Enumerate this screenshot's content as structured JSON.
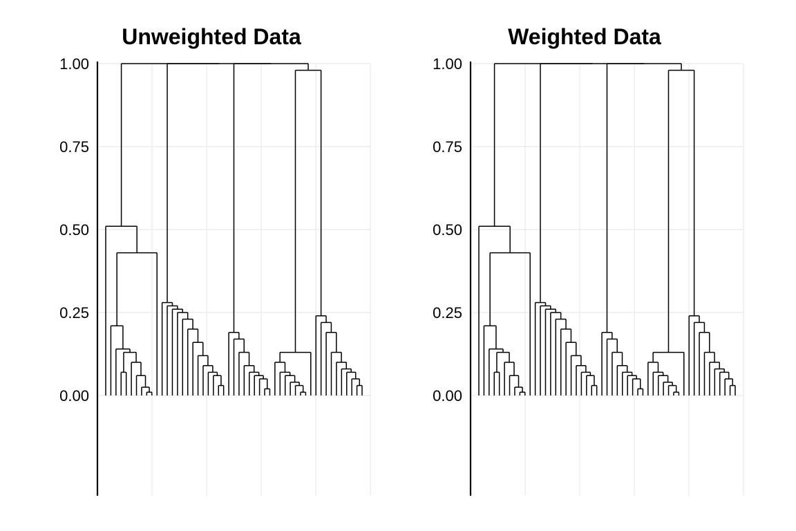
{
  "chart_data": [
    {
      "type": "dendrogram",
      "title": "Unweighted Data",
      "ylim": [
        0.0,
        1.0
      ],
      "yticks": [
        0.0,
        0.25,
        0.5,
        0.75,
        1.0
      ],
      "ytick_labels": [
        "0.00",
        "0.25",
        "0.50",
        "0.75",
        "1.00"
      ],
      "n_leaves": 47,
      "merges": [
        {
          "height": 0.01,
          "left": "L0",
          "right": "L1",
          "id": "M0"
        },
        {
          "height": 0.025,
          "left": "L2",
          "right": "M0",
          "id": "M1"
        },
        {
          "height": 0.06,
          "left": "L3",
          "right": "M1",
          "id": "M2"
        },
        {
          "height": 0.1,
          "left": "L4",
          "right": "M2",
          "id": "M3"
        },
        {
          "height": 0.07,
          "left": "L5",
          "right": "L6",
          "id": "M4"
        },
        {
          "height": 0.13,
          "left": "M4",
          "right": "M3",
          "id": "M5"
        },
        {
          "height": 0.14,
          "left": "L7",
          "right": "M5",
          "id": "M6"
        },
        {
          "height": 0.21,
          "left": "L8",
          "right": "M6",
          "id": "M7"
        },
        {
          "height": 0.43,
          "left": "M7",
          "right": "L9",
          "id": "M8"
        },
        {
          "height": 0.51,
          "left": "L10",
          "right": "M8",
          "id": "C1"
        },
        {
          "height": 0.03,
          "left": "L11",
          "right": "L12",
          "id": "M10"
        },
        {
          "height": 0.06,
          "left": "L13",
          "right": "M10",
          "id": "M11"
        },
        {
          "height": 0.07,
          "left": "L14",
          "right": "M11",
          "id": "M12"
        },
        {
          "height": 0.09,
          "left": "L15",
          "right": "M12",
          "id": "M13"
        },
        {
          "height": 0.12,
          "left": "L16",
          "right": "M13",
          "id": "M14"
        },
        {
          "height": 0.16,
          "left": "L17",
          "right": "M14",
          "id": "M15"
        },
        {
          "height": 0.2,
          "left": "L18",
          "right": "M15",
          "id": "M16"
        },
        {
          "height": 0.23,
          "left": "L19",
          "right": "M16",
          "id": "M17"
        },
        {
          "height": 0.25,
          "left": "L20",
          "right": "M17",
          "id": "M18"
        },
        {
          "height": 0.26,
          "left": "L21",
          "right": "M18",
          "id": "M19"
        },
        {
          "height": 0.27,
          "left": "L22",
          "right": "M19",
          "id": "M20"
        },
        {
          "height": 0.28,
          "left": "L23",
          "right": "M20",
          "id": "C2"
        },
        {
          "height": 0.02,
          "left": "L24",
          "right": "L25",
          "id": "M22"
        },
        {
          "height": 0.05,
          "left": "L26",
          "right": "M22",
          "id": "M23"
        },
        {
          "height": 0.06,
          "left": "L27",
          "right": "M23",
          "id": "M24"
        },
        {
          "height": 0.07,
          "left": "L28",
          "right": "M24",
          "id": "M25"
        },
        {
          "height": 0.09,
          "left": "L29",
          "right": "M25",
          "id": "M26"
        },
        {
          "height": 0.13,
          "left": "L30",
          "right": "M26",
          "id": "M27"
        },
        {
          "height": 0.17,
          "left": "L31",
          "right": "M27",
          "id": "M28"
        },
        {
          "height": 0.19,
          "left": "L32",
          "right": "M28",
          "id": "C3"
        },
        {
          "height": 0.01,
          "left": "L33",
          "right": "L34",
          "id": "M30"
        },
        {
          "height": 0.03,
          "left": "L35",
          "right": "M30",
          "id": "M31"
        },
        {
          "height": 0.04,
          "left": "L36",
          "right": "M31",
          "id": "M32"
        },
        {
          "height": 0.06,
          "left": "L37",
          "right": "M32",
          "id": "M33"
        },
        {
          "height": 0.07,
          "left": "L38",
          "right": "M33",
          "id": "M34"
        },
        {
          "height": 0.1,
          "left": "L39",
          "right": "M34",
          "id": "M35"
        },
        {
          "height": 0.13,
          "left": "M35",
          "right": "L40",
          "id": "C4"
        },
        {
          "height": 0.03,
          "left": "L41",
          "right": "L42",
          "id": "M37"
        },
        {
          "height": 0.05,
          "left": "L43",
          "right": "M37",
          "id": "M38"
        },
        {
          "height": 0.07,
          "left": "L44",
          "right": "M38",
          "id": "M39"
        },
        {
          "height": 0.08,
          "left": "L45",
          "right": "M39",
          "id": "M40"
        },
        {
          "height": 0.1,
          "left": "L46",
          "right": "M40",
          "id": "M41"
        },
        {
          "height": 0.13,
          "left": "L47",
          "right": "M41",
          "id": "M42"
        },
        {
          "height": 0.19,
          "left": "L48",
          "right": "M42",
          "id": "M43"
        },
        {
          "height": 0.22,
          "left": "L49",
          "right": "M43",
          "id": "M44"
        },
        {
          "height": 0.24,
          "left": "L50",
          "right": "M44",
          "id": "C5"
        },
        {
          "height": 0.98,
          "left": "C4",
          "right": "C5",
          "id": "T45"
        },
        {
          "height": 1.0,
          "left": "C3",
          "right": "T45",
          "id": "T3"
        },
        {
          "height": 1.0,
          "left": "C2",
          "right": "T3",
          "id": "T2"
        },
        {
          "height": 1.0,
          "left": "C1",
          "right": "T2",
          "id": "ROOT"
        }
      ]
    },
    {
      "type": "dendrogram",
      "title": "Weighted Data",
      "ylim": [
        0.0,
        1.0
      ],
      "yticks": [
        0.0,
        0.25,
        0.5,
        0.75,
        1.0
      ],
      "ytick_labels": [
        "0.00",
        "0.25",
        "0.50",
        "0.75",
        "1.00"
      ],
      "n_leaves": 47,
      "merges": "same_as_panel_0"
    }
  ]
}
